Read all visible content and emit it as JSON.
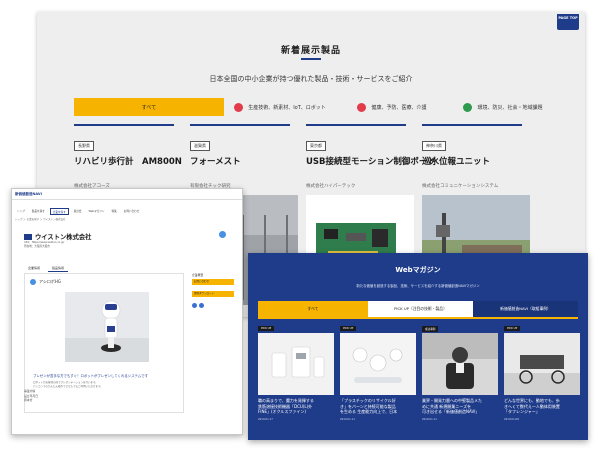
{
  "shot_a": {
    "badge": "PAGE TOP",
    "title": "新着展示製品",
    "subtitle": "日本全国の中小企業が持つ優れた製品・技術・サービスをご紹介",
    "tabs": [
      {
        "label": "すべて",
        "active": true,
        "icon": ""
      },
      {
        "label": "生産技術、新素材、IoT、ロボット",
        "active": false,
        "icon": "gear-icon"
      },
      {
        "label": "健康、予防、医療、介護",
        "active": false,
        "icon": "heart-icon"
      },
      {
        "label": "環境、防災、社会・地域課題",
        "active": false,
        "icon": "leaf-icon"
      }
    ],
    "cards": [
      {
        "pref": "長野県",
        "name": "リハビリ歩行計　AM800N",
        "company": "株式会社アコーズ",
        "icon_color": "#e23b4a"
      },
      {
        "pref": "滋賀県",
        "name": "フォーメスト",
        "company": "有限会社チック研究",
        "icon_color": "#2e9a4b"
      },
      {
        "pref": "東京都",
        "name": "USB接続型モーション制御ボード",
        "company": "株式会社ハイパーテック",
        "icon_color": "#f6b400"
      },
      {
        "pref": "神奈川県",
        "name": "巡水位報ユニット",
        "company": "株式会社コミュニケーションシステム",
        "icon_color": "#2e9a4b"
      }
    ]
  },
  "shot_b": {
    "logo": "新価値創造NAVI",
    "nav": [
      "トップ",
      "製品を探す",
      "企業を探す",
      "展示会",
      "Webマガジン",
      "特集",
      "お問い合わせ"
    ],
    "crumb": "トップ ＞ 企業を探す ＞ ウイストン株式会社",
    "company": "ウイストン株式会社",
    "meta": [
      "URL：https://www.wiston.co.jp/",
      "所在地：大阪府大阪市"
    ],
    "tabs": [
      "企業情報",
      "製品情報"
    ],
    "product": "アシロボHG",
    "caption": "プレゼンが苦手な方でもすぐ！ロボットがプレゼンしてくれるシステムです",
    "desc": [
      "ロボットがお客様の前でプレゼンテーションを行います。",
      "パソコンでのかんたん操作でどなたでもご利用いただけます。"
    ],
    "side": [
      "企業概要",
      "お問い合わせ",
      "資料ダウンロード"
    ],
    "foot": [
      "事業内容",
      "設立年月日",
      "資本金"
    ]
  },
  "shot_c": {
    "title": "Webマガジン",
    "subtitle": "新たな価値を創造する製品、技術、サービスを紹介する新価値創造NAVIマガジン",
    "tabs": [
      "すべて",
      "PICK UP（注目の技術・製品）",
      "新価値創造NAVI（取組事例）"
    ],
    "cards": [
      {
        "tag": "PICK UP",
        "text": [
          "職の高まりで、魔力を発揮する",
          "鉄筋溶接技術機器「DCU(L)外",
          "FINE」(オクルスファイン)"
        ],
        "date": "2019.01.17"
      },
      {
        "tag": "PICK UP",
        "text": [
          "「プラスチックのリサイクル好",
          "き」をバーンと持続可能な製品",
          "を生める 生産能力向上で、日本"
        ],
        "date": "2019.01.11"
      },
      {
        "tag": "成功事例",
        "text": [
          "業界・開発力層への中堅製品メた",
          "めに共通 新規開業ニーズを",
          "可き出せる「新価値創造NAVI」"
        ],
        "date": "2019.01.11"
      },
      {
        "tag": "PICK UP",
        "text": [
          "どんな世界にも、動地でも、歩",
          "きへくて数代え一人動体用装置",
          "「タフレンジャー」"
        ],
        "date": "2019.01.08"
      }
    ]
  }
}
